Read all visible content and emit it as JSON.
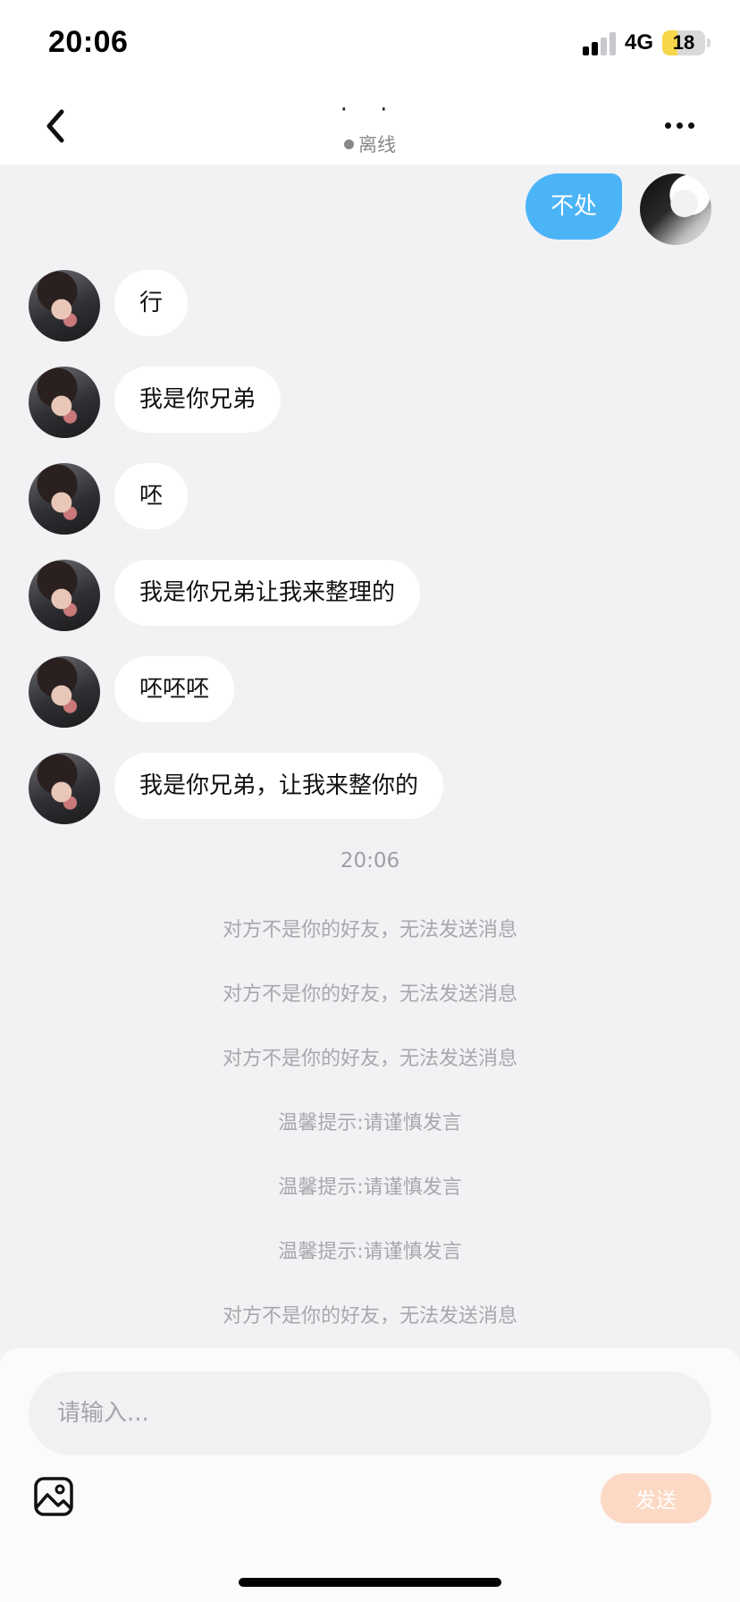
{
  "status_bar": {
    "time": "20:06",
    "network": "4G",
    "battery_level": "18",
    "battery_fraction": 0.18,
    "signal_bars_active": 2,
    "signal_bars_total": 4
  },
  "header": {
    "contact_name": "· ·",
    "presence": "离线",
    "icons": {
      "back": "chevron-left-icon",
      "more": "more-dots-icon"
    }
  },
  "messages": [
    {
      "from": "self",
      "text": "不处"
    },
    {
      "from": "peer",
      "text": "行"
    },
    {
      "from": "peer",
      "text": "我是你兄弟"
    },
    {
      "from": "peer",
      "text": "呸"
    },
    {
      "from": "peer",
      "text": "我是你兄弟让我来整理的"
    },
    {
      "from": "peer",
      "text": "呸呸呸"
    },
    {
      "from": "peer",
      "text": "我是你兄弟，让我来整你的"
    }
  ],
  "timestamp": "20:06",
  "system_messages": [
    "对方不是你的好友，无法发送消息",
    "对方不是你的好友，无法发送消息",
    "对方不是你的好友，无法发送消息",
    "温馨提示:请谨慎发言",
    "温馨提示:请谨慎发言",
    "温馨提示:请谨慎发言",
    "对方不是你的好友，无法发送消息"
  ],
  "composer": {
    "placeholder": "请输入...",
    "value": "",
    "send_label": "发送",
    "image_icon": "image-icon"
  },
  "colors": {
    "self_bubble": "#4bb4f7",
    "peer_bubble": "#ffffff",
    "background": "#f2f2f4",
    "send_button": "#fcd9c4"
  }
}
